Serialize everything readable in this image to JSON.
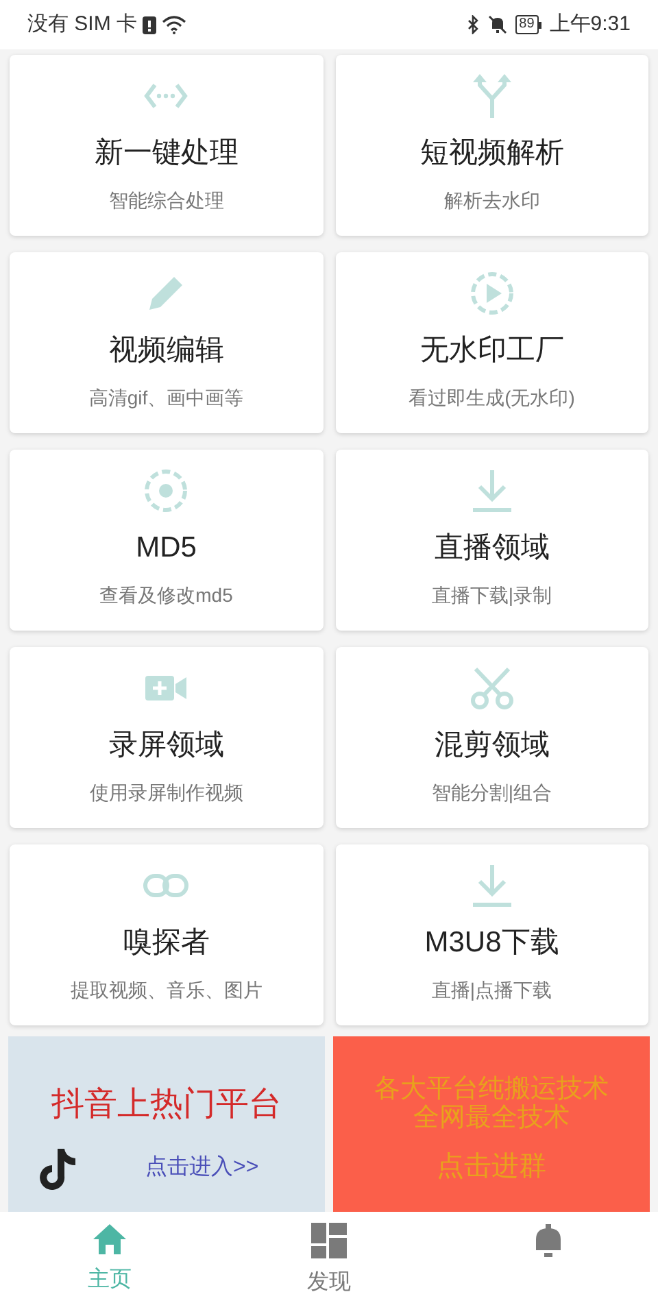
{
  "status_bar": {
    "carrier": "没有 SIM 卡",
    "battery": "89",
    "time": "上午9:31"
  },
  "tools": [
    {
      "title": "新一键处理",
      "subtitle": "智能综合处理"
    },
    {
      "title": "短视频解析",
      "subtitle": "解析去水印"
    },
    {
      "title": "视频编辑",
      "subtitle": "高清gif、画中画等"
    },
    {
      "title": "无水印工厂",
      "subtitle": "看过即生成(无水印)"
    },
    {
      "title": "MD5",
      "subtitle": "查看及修改md5"
    },
    {
      "title": "直播领域",
      "subtitle": "直播下载|录制"
    },
    {
      "title": "录屏领域",
      "subtitle": "使用录屏制作视频"
    },
    {
      "title": "混剪领域",
      "subtitle": "智能分割|组合"
    },
    {
      "title": "嗅探者",
      "subtitle": "提取视频、音乐、图片"
    },
    {
      "title": "M3U8下载",
      "subtitle": "直播|点播下载"
    }
  ],
  "banners": {
    "left": {
      "title": "抖音上热门平台",
      "link": "点击进入>>"
    },
    "right": {
      "lines": [
        "各大平台纯搬运技术",
        "全网最全技术"
      ],
      "action": "点击进群"
    }
  },
  "nav": [
    {
      "label": "主页",
      "selected": true
    },
    {
      "label": "发现",
      "selected": false
    },
    {
      "selected": false
    }
  ]
}
